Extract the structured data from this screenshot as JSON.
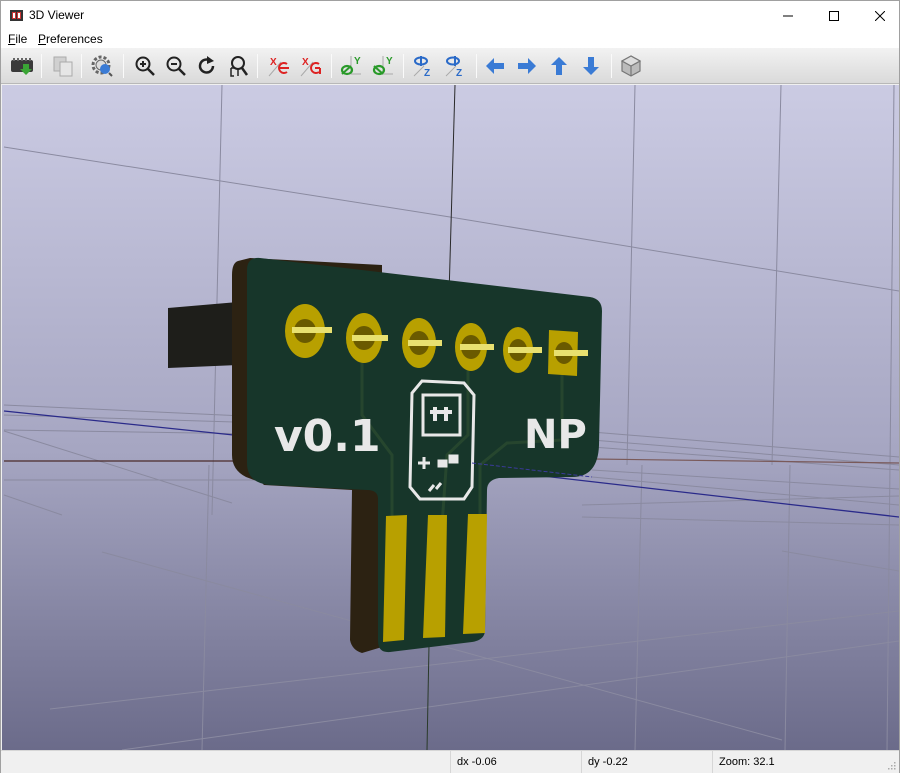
{
  "window": {
    "title": "3D Viewer",
    "controls": {
      "minimize": "minimize-icon",
      "maximize": "maximize-icon",
      "close": "close-icon"
    }
  },
  "menubar": {
    "items": [
      {
        "label": "File",
        "accel": "F",
        "rest": "ile"
      },
      {
        "label": "Preferences",
        "accel": "P",
        "rest": "references"
      }
    ]
  },
  "toolbar": {
    "buttons": [
      {
        "name": "reload-board",
        "icon": "reload-board-icon"
      },
      {
        "name": "copy-image",
        "icon": "copy-icon"
      },
      {
        "name": "render-options",
        "icon": "render-settings-icon"
      },
      {
        "name": "zoom-in",
        "icon": "zoom-in-icon"
      },
      {
        "name": "zoom-out",
        "icon": "zoom-out-icon"
      },
      {
        "name": "redraw",
        "icon": "redraw-icon"
      },
      {
        "name": "zoom-fit",
        "icon": "zoom-fit-icon"
      },
      {
        "name": "rotate-x-cw",
        "icon": "rotate-x-cw-icon",
        "axis": "X"
      },
      {
        "name": "rotate-x-ccw",
        "icon": "rotate-x-ccw-icon",
        "axis": "X"
      },
      {
        "name": "rotate-y-cw",
        "icon": "rotate-y-cw-icon",
        "axis": "Y"
      },
      {
        "name": "rotate-y-ccw",
        "icon": "rotate-y-ccw-icon",
        "axis": "Y"
      },
      {
        "name": "rotate-z-cw",
        "icon": "rotate-z-cw-icon",
        "axis": "Z"
      },
      {
        "name": "rotate-z-ccw",
        "icon": "rotate-z-ccw-icon",
        "axis": "Z"
      },
      {
        "name": "move-left",
        "icon": "arrow-left-icon"
      },
      {
        "name": "move-right",
        "icon": "arrow-right-icon"
      },
      {
        "name": "move-up",
        "icon": "arrow-up-icon"
      },
      {
        "name": "move-down",
        "icon": "arrow-down-icon"
      },
      {
        "name": "toggle-projection",
        "icon": "ortho-cube-icon"
      }
    ]
  },
  "scene": {
    "board": {
      "silkscreen_left": "v0.1",
      "silkscreen_right": "NP",
      "pad_count": 6,
      "edge_contact_count": 3
    },
    "colors": {
      "background_top": "#cbcbe3",
      "background_bottom": "#6b6b8a",
      "solder_mask": "#17362a",
      "board_edge": "#2c2212",
      "copper": "#b8a000",
      "silkscreen": "#e8e8e8",
      "grid": "#7a7a8c",
      "axis_x": "#2a2a8a",
      "axis_y": "#5a2a2a"
    }
  },
  "statusbar": {
    "dx": "dx -0.06",
    "dy": "dy -0.22",
    "zoom": "Zoom: 32.1"
  }
}
